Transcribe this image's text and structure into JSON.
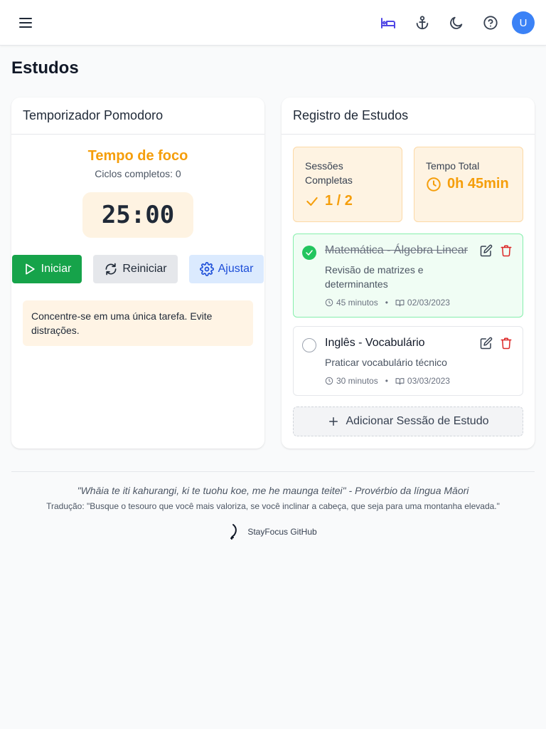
{
  "header": {
    "icons": [
      "menu-icon",
      "bed-icon",
      "anchor-icon",
      "moon-icon",
      "help-icon"
    ],
    "avatar_letter": "U",
    "accent": "#4f46e5"
  },
  "page_title": "Estudos",
  "pomodoro": {
    "title": "Temporizador Pomodoro",
    "mode": "Tempo de foco",
    "cycles": "Ciclos completos: 0",
    "time": "25:00",
    "start_label": "Iniciar",
    "reset_label": "Reiniciar",
    "adjust_label": "Ajustar",
    "tip": "Concentre-se em uma única tarefa. Evite distrações."
  },
  "log": {
    "title": "Registro de Estudos",
    "completed_label": "Sessões Completas",
    "completed_value": "1 / 2",
    "total_label": "Tempo Total",
    "total_value": "0h 45min",
    "sessions": [
      {
        "title": "Matemática - Álgebra Linear",
        "description": "Revisão de matrizes e determinantes",
        "duration": "45 minutos",
        "date": "02/03/2023",
        "completed": true
      },
      {
        "title": "Inglês - Vocabulário",
        "description": "Praticar vocabulário técnico",
        "duration": "30 minutos",
        "date": "03/03/2023",
        "completed": false
      }
    ],
    "add_label": "Adicionar Sessão de Estudo"
  },
  "footer": {
    "quote": "\"Whāia te iti kahurangi, ki te tuohu koe, me he maunga teitei\" - Provérbio da língua Māori",
    "translation": "Tradução: \"Busque o tesouro que você mais valoriza, se você inclinar a cabeça, que seja para uma montanha elevada.\"",
    "link_label": "StayFocus GitHub"
  },
  "colors": {
    "success": "#16a34a",
    "warning": "#f59e0b",
    "danger": "#dc2626",
    "info": "#3b82f6"
  }
}
